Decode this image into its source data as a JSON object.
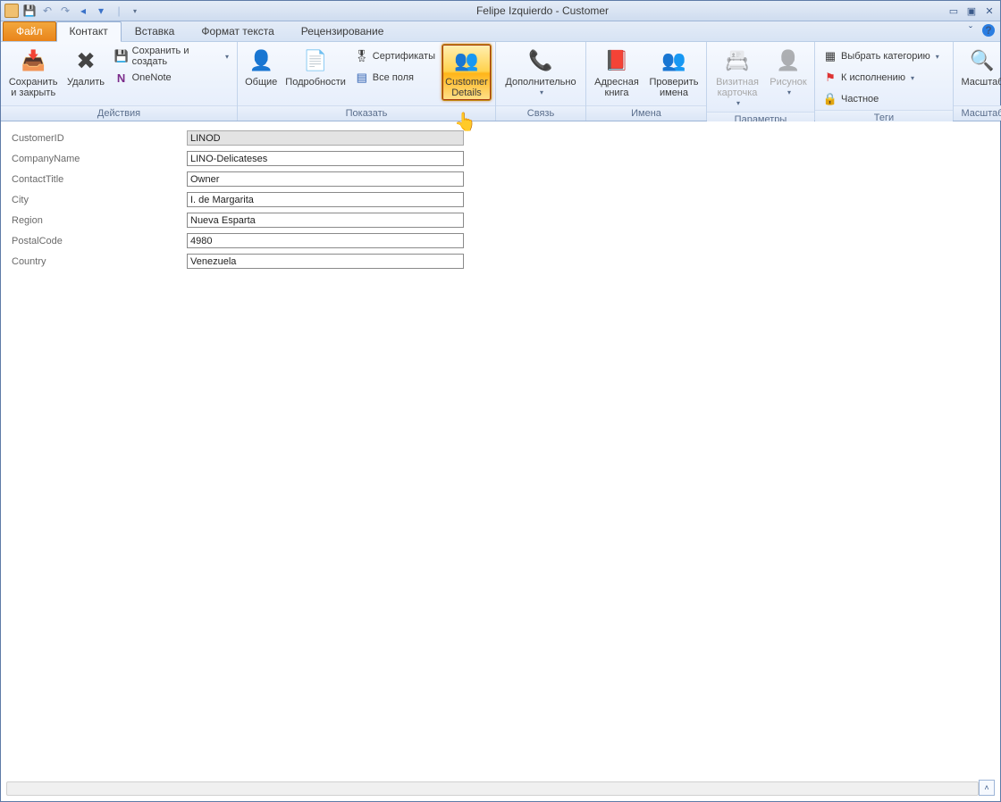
{
  "titlebar": {
    "title": "Felipe Izquierdo - Customer"
  },
  "tabs": {
    "file": "Файл",
    "contact": "Контакт",
    "insert": "Вставка",
    "format": "Формат текста",
    "review": "Рецензирование"
  },
  "ribbon": {
    "actions": {
      "label": "Действия",
      "save_close": "Сохранить и закрыть",
      "delete": "Удалить",
      "save_create": "Сохранить и создать",
      "onenote": "OneNote"
    },
    "show": {
      "label": "Показать",
      "general": "Общие",
      "details": "Подробности",
      "certificates": "Сертификаты",
      "all_fields": "Все поля",
      "customer_details": "Customer Details"
    },
    "comm": {
      "label": "Связь",
      "more": "Дополнительно"
    },
    "names": {
      "label": "Имена",
      "address_book": "Адресная книга",
      "check_names": "Проверить имена"
    },
    "params": {
      "label": "Параметры",
      "business_card": "Визитная карточка",
      "picture": "Рисунок"
    },
    "tags": {
      "label": "Теги",
      "category": "Выбрать категорию",
      "followup": "К исполнению",
      "private": "Частное"
    },
    "zoom": {
      "label": "Масштаб",
      "zoom": "Масштаб"
    }
  },
  "form": {
    "fields": [
      {
        "label": "CustomerID",
        "value": "LINOD",
        "readonly": true
      },
      {
        "label": "CompanyName",
        "value": "LINO-Delicateses",
        "readonly": false
      },
      {
        "label": "ContactTitle",
        "value": "Owner",
        "readonly": false
      },
      {
        "label": "City",
        "value": "I. de Margarita",
        "readonly": false
      },
      {
        "label": "Region",
        "value": "Nueva Esparta",
        "readonly": false
      },
      {
        "label": "PostalCode",
        "value": "4980",
        "readonly": false
      },
      {
        "label": "Country",
        "value": "Venezuela",
        "readonly": false
      }
    ]
  }
}
